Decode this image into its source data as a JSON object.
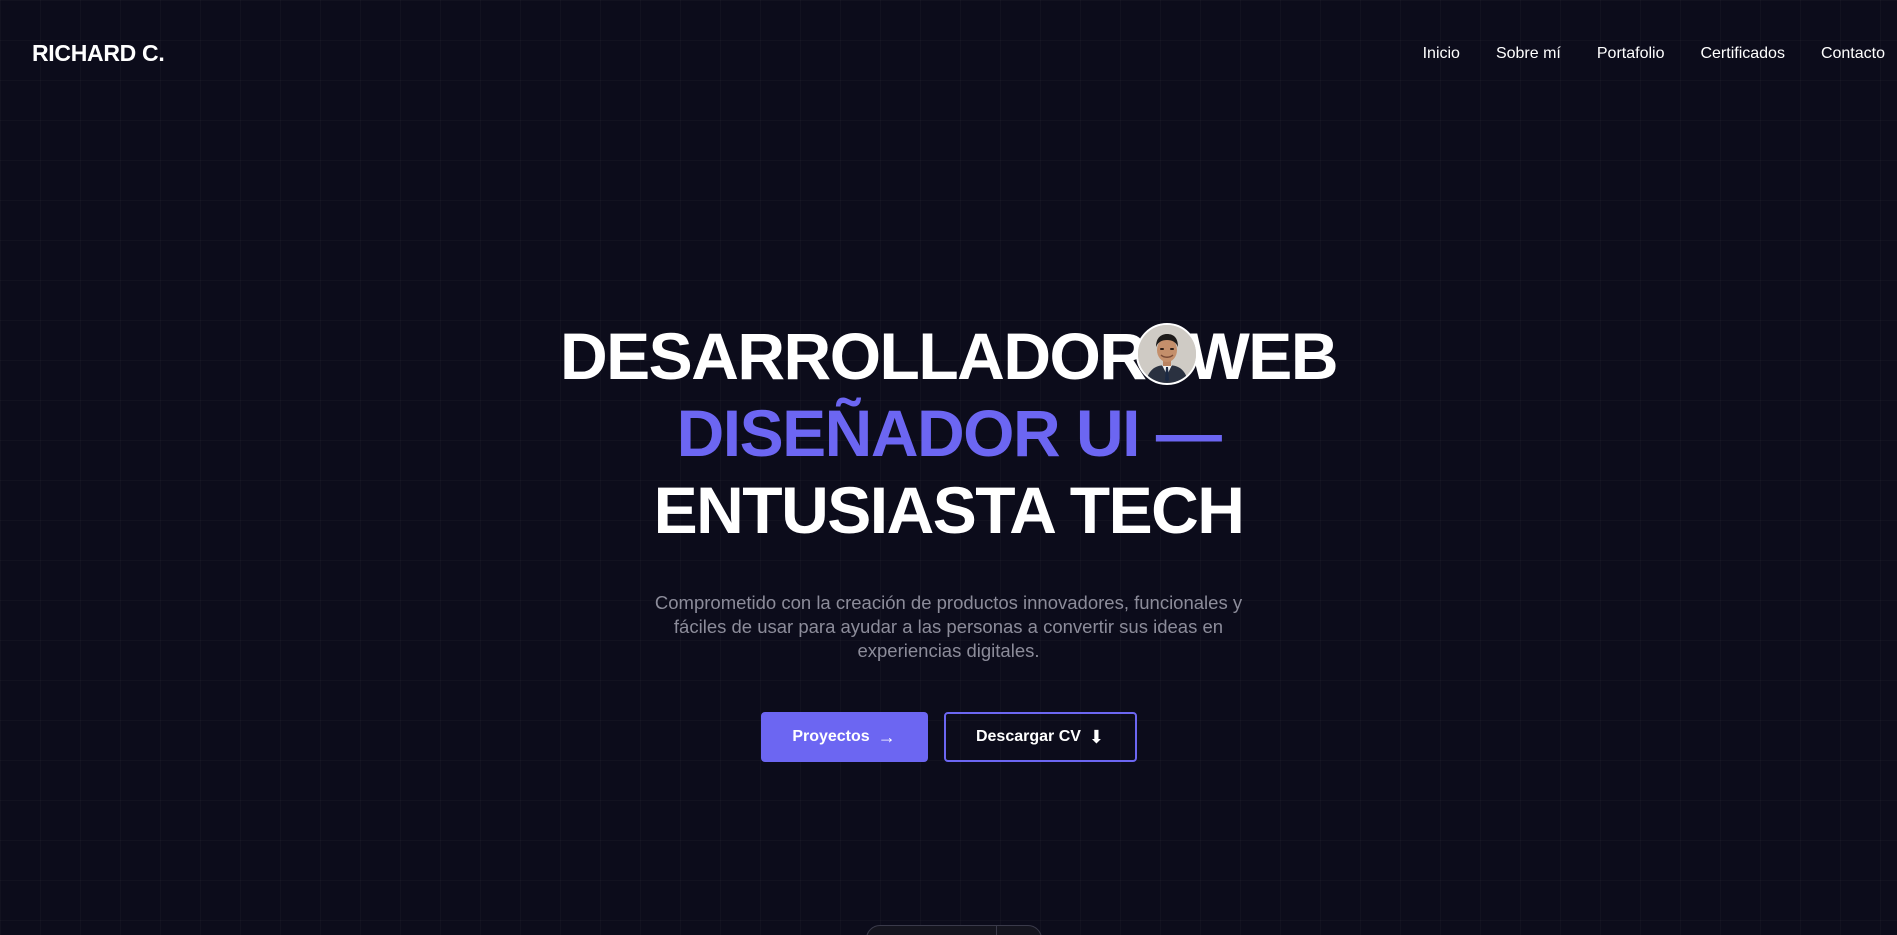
{
  "brand": "RICHARD C.",
  "nav": {
    "items": [
      "Inicio",
      "Sobre mí",
      "Portafolio",
      "Certificados",
      "Contacto"
    ]
  },
  "hero": {
    "line1_before": "DESARROLLADOR",
    "line1_after": "WEB",
    "line2": "DISEÑADOR UI —",
    "line3": "ENTUSIASTA TECH",
    "subtitle": "Comprometido con la creación de productos innovadores, funcionales y fáciles de usar para ayudar a las personas a convertir sus ideas en experiencias digitales.",
    "primary_button": "Proyectos",
    "primary_icon": "→",
    "secondary_button": "Descargar CV",
    "secondary_icon": "⬇"
  },
  "colors": {
    "background": "#0c0c1b",
    "accent": "#6c66f2",
    "muted_text": "#8c8c9a"
  },
  "icons": {
    "primary_button_icon": "arrow-right-icon",
    "secondary_button_icon": "download-icon"
  }
}
